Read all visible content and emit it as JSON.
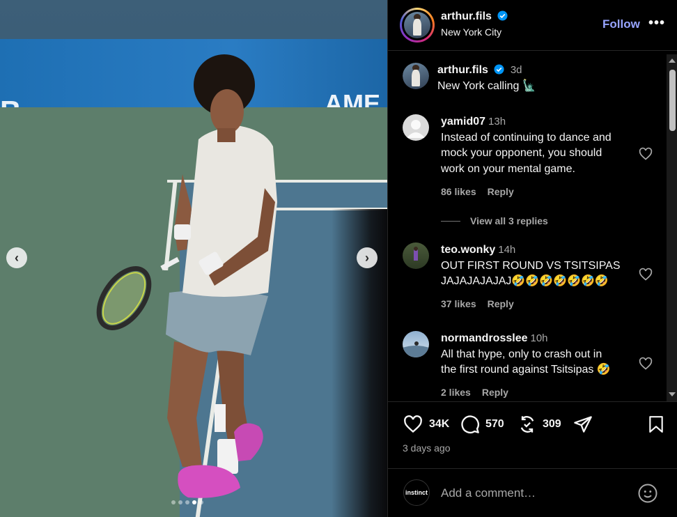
{
  "media": {
    "banner_left": "B",
    "banner_right": "AME\nEX",
    "prev_arrow": "‹",
    "next_arrow": "›",
    "slide_count": 5,
    "active_slide": 4
  },
  "header": {
    "username": "arthur.fils",
    "location": "New York City",
    "follow_label": "Follow",
    "more_label": "•••"
  },
  "caption": {
    "username": "arthur.fils",
    "time": "3d",
    "text": "New York calling 🗽"
  },
  "comments": [
    {
      "username": "yamid07",
      "time": "13h",
      "lines": [
        "Instead of continuing to dance and",
        "mock your opponent, you should",
        "work on your mental game."
      ],
      "likes": "86 likes",
      "reply": "Reply",
      "view_replies": "View all 3 replies"
    },
    {
      "username": "teo.wonky",
      "time": "14h",
      "lines": [
        "OUT FIRST ROUND VS TSITSIPAS",
        "JAJAJAJAJAJ🤣🤣🤣🤣🤣🤣🤣"
      ],
      "likes": "37 likes",
      "reply": "Reply"
    },
    {
      "username": "normandrosslee",
      "time": "10h",
      "lines": [
        "All that hype, only to crash out in",
        "the first round against Tsitsipas 🤣"
      ],
      "likes": "2 likes",
      "reply": "Reply"
    }
  ],
  "actions": {
    "likes": "34K",
    "comments": "570",
    "reposts": "309",
    "posted": "3 days ago"
  },
  "add_comment": {
    "avatar_label": "instinct",
    "placeholder": "Add a comment…"
  },
  "colors": {
    "follow": "#97a4ff",
    "verified": "#0095f6",
    "muted": "#a8a8a8"
  }
}
